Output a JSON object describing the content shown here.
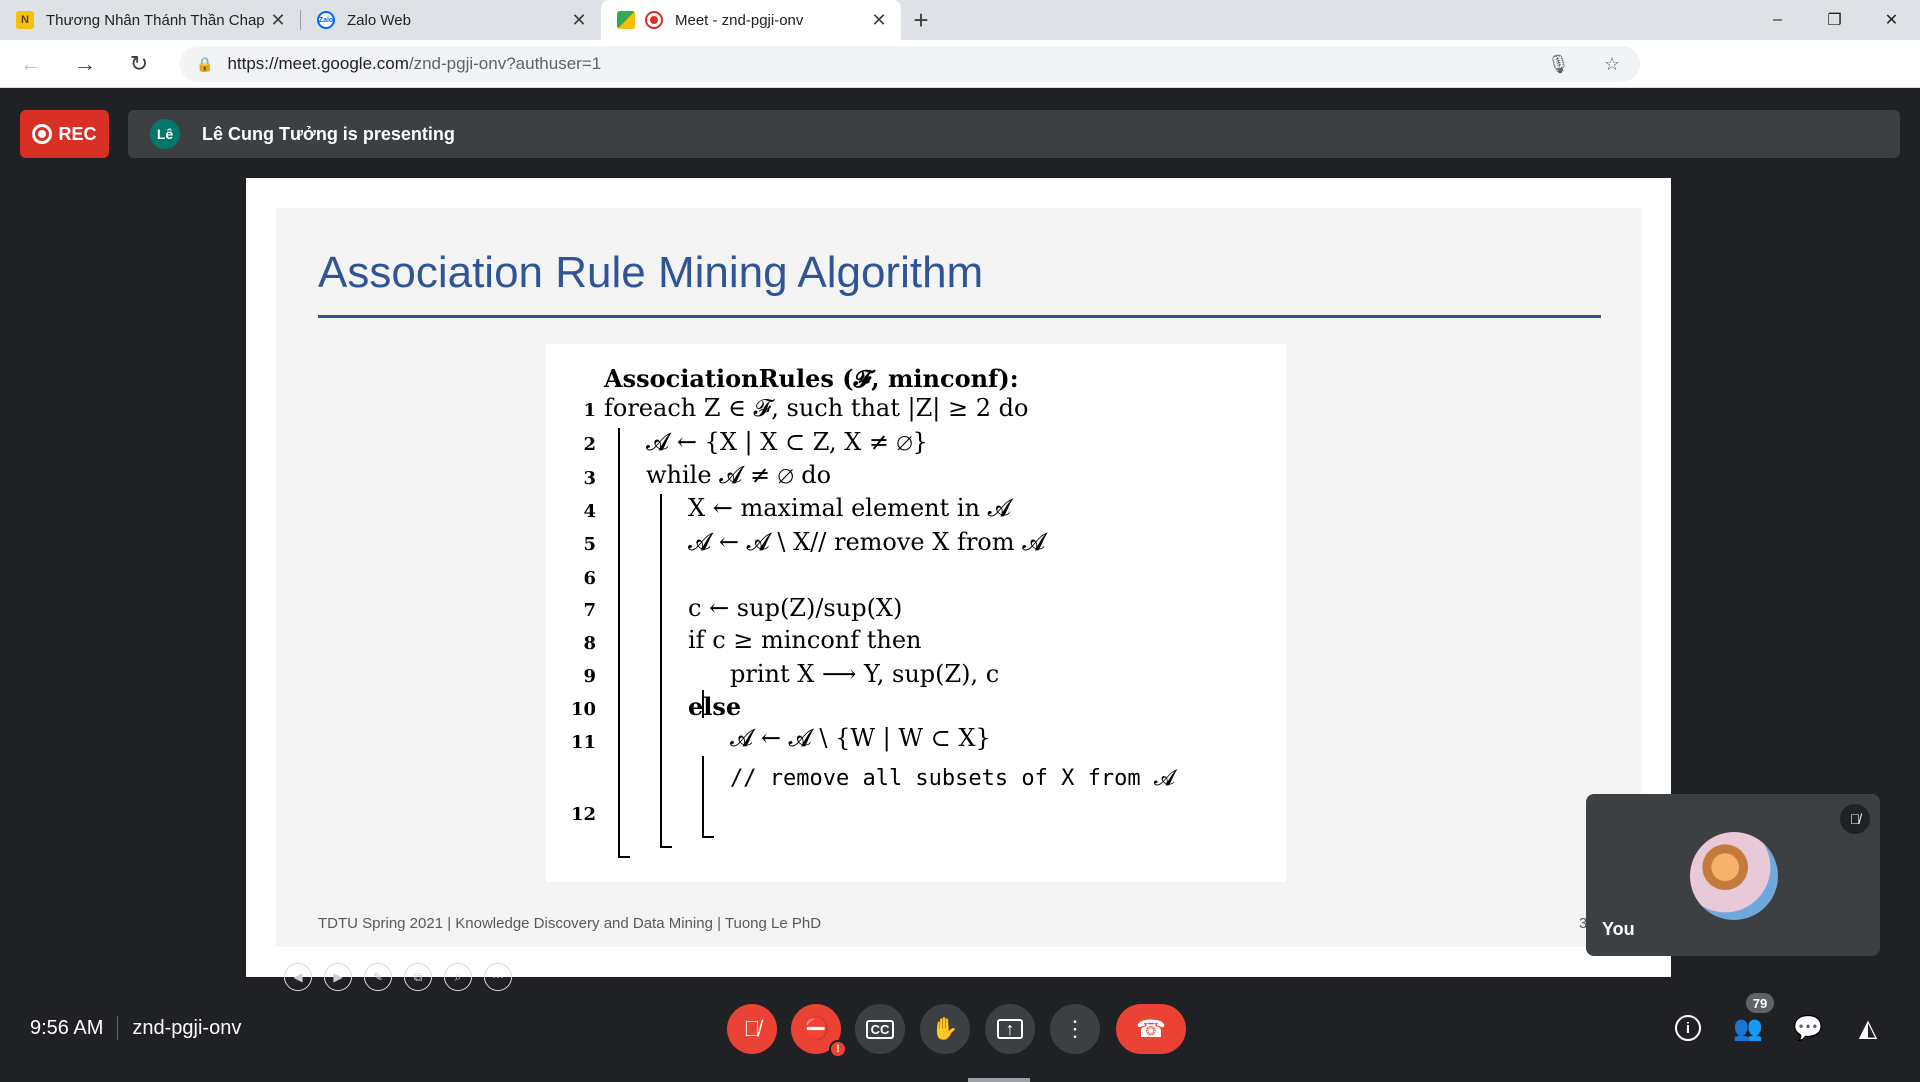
{
  "browser": {
    "tabs": [
      {
        "title": "Thương Nhân Thánh Thần Chap",
        "favicon": "novel-site-icon",
        "active": false
      },
      {
        "title": "Zalo Web",
        "favicon": "zalo-icon",
        "active": false
      },
      {
        "title": "Meet - znd-pgji-onv",
        "favicon": "google-meet-icon",
        "active": true
      }
    ],
    "new_tab_label": "+",
    "url_host": "https://meet.google.com",
    "url_path": "/znd-pgji-onv?authuser=1",
    "window_controls": {
      "minimize": "–",
      "restore": "❐",
      "close": "✕"
    }
  },
  "meet": {
    "rec_label": "REC",
    "presenter_initials": "Lê",
    "presenting_text": "Lê Cung Tưởng is presenting",
    "self_label": "You",
    "time": "9:56 AM",
    "meeting_code": "znd-pgji-onv",
    "participant_count": "79",
    "colors": {
      "rec": "#d93025",
      "danger": "#ea4335",
      "surface": "#3c4043",
      "background": "#202124"
    }
  },
  "slide": {
    "title": "Association Rule Mining Algorithm",
    "footer": "TDTU Spring 2021 | Knowledge Discovery and Data Mining | Tuong Le PhD",
    "page_number": "3",
    "title_color": "#2f5597",
    "algorithm": {
      "header": "AssociationRules (𝓕, minconf):",
      "lines": [
        {
          "n": "1",
          "text": "foreach Z ∈ 𝓕, such that |Z| ≥ 2 do"
        },
        {
          "n": "2",
          "text": "𝓐 ← {X | X ⊂ Z, X ≠ ∅}"
        },
        {
          "n": "3",
          "text": "while 𝓐 ≠ ∅ do"
        },
        {
          "n": "4",
          "text": "X ← maximal element in 𝓐"
        },
        {
          "n": "5",
          "text": "𝓐 ← 𝓐 \\ X// remove X from 𝓐"
        },
        {
          "n": "6",
          "text": ""
        },
        {
          "n": "7",
          "text": "c ← sup(Z)/sup(X)"
        },
        {
          "n": "8",
          "text": "if c ≥ minconf then"
        },
        {
          "n": "9",
          "text": "print X ⟶ Y, sup(Z), c"
        },
        {
          "n": "10",
          "text": "else"
        },
        {
          "n": "11",
          "text": "𝓐 ← 𝓐 \\ {W | W ⊂ X}"
        },
        {
          "n": "",
          "text": "// remove all subsets of X from 𝓐"
        },
        {
          "n": "12",
          "text": ""
        }
      ]
    }
  }
}
